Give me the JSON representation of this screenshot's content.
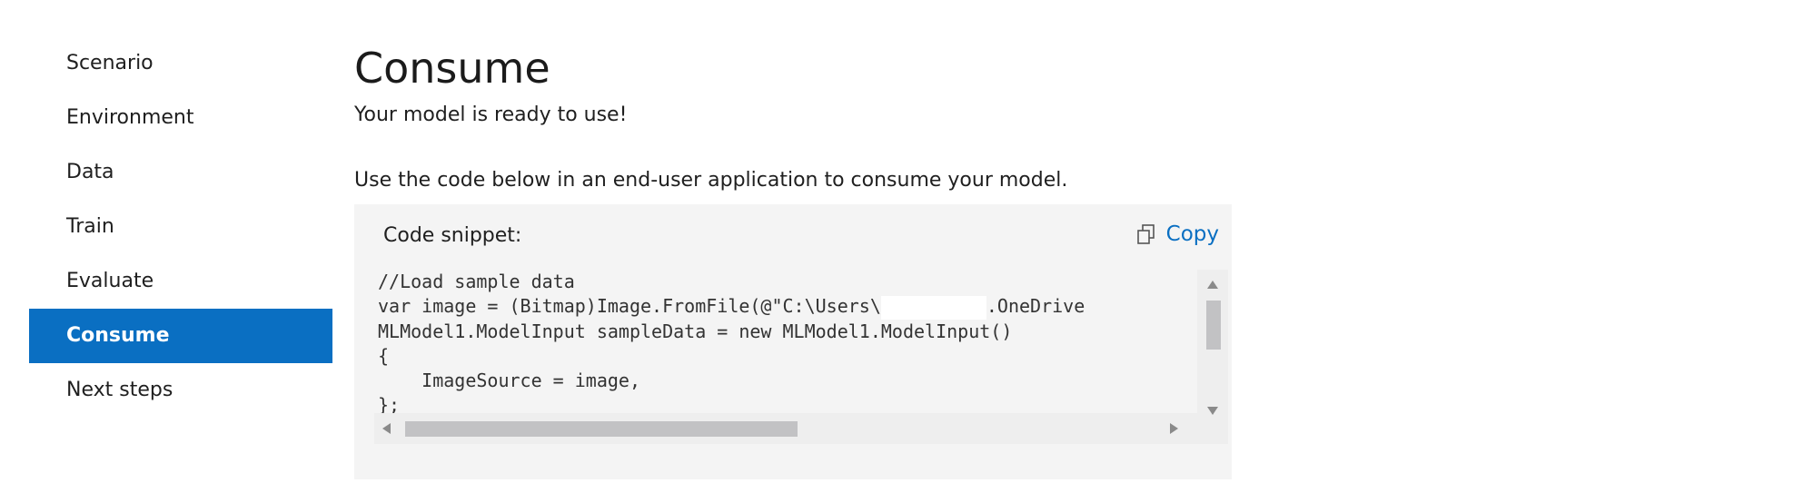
{
  "sidebar": {
    "items": [
      {
        "label": "Scenario",
        "active": false
      },
      {
        "label": "Environment",
        "active": false
      },
      {
        "label": "Data",
        "active": false
      },
      {
        "label": "Train",
        "active": false
      },
      {
        "label": "Evaluate",
        "active": false
      },
      {
        "label": "Consume",
        "active": true
      },
      {
        "label": "Next steps",
        "active": false
      }
    ]
  },
  "main": {
    "title": "Consume",
    "subtitle": "Your model is ready to use!",
    "instruction": "Use the code below in an end-user application to consume your model."
  },
  "code_panel": {
    "label": "Code snippet:",
    "copy_label": "Copy",
    "copy_icon": "copy-icon",
    "lines": [
      "//Load sample data",
      "var image = (Bitmap)Image.FromFile(@\"C:\\Users\\",
      "MLModel1.ModelInput sampleData = new MLModel1.ModelInput()",
      "{",
      "    ImageSource = image,",
      "};"
    ],
    "line2_suffix": ".OneDrive"
  },
  "colors": {
    "accent": "#0a6fc2",
    "panel_bg": "#f4f4f4",
    "scroll_thumb": "#c2c2c4"
  }
}
